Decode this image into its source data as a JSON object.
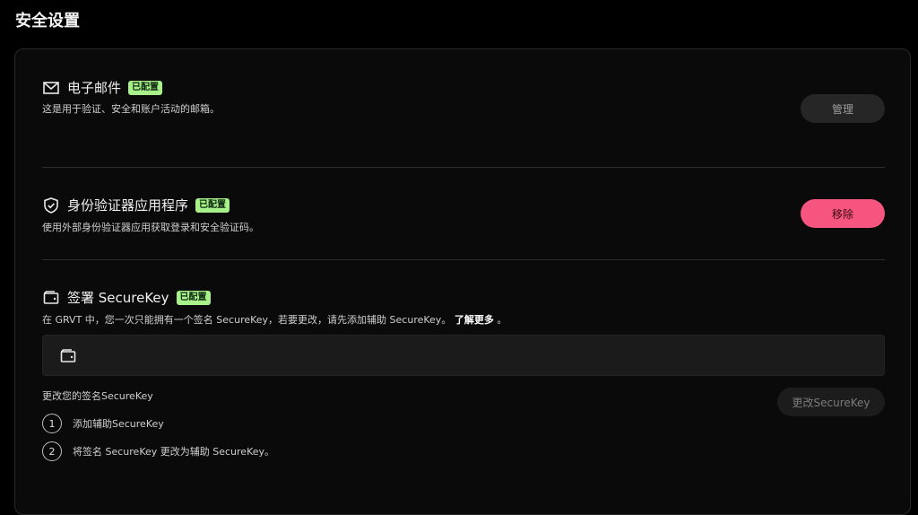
{
  "page": {
    "title": "安全设置"
  },
  "email": {
    "title": "电子邮件",
    "badge": "已配置",
    "description": "这是用于验证、安全和账户活动的邮箱。",
    "button": "管理"
  },
  "authenticator": {
    "title": "身份验证器应用程序",
    "badge": "已配置",
    "description": "使用外部身份验证器应用获取登录和安全验证码。",
    "button": "移除"
  },
  "securekey": {
    "title": "签署 SecureKey",
    "badge": "已配置",
    "description": "在 GRVT 中，您一次只能拥有一个签名 SecureKey，若要更改，请先添加辅助 SecureKey。",
    "learn_more": "了解更多",
    "trailing_dot": "。",
    "change_label": "更改您的签名SecureKey",
    "change_button": "更改SecureKey",
    "steps": [
      {
        "num": "1",
        "text": "添加辅助SecureKey"
      },
      {
        "num": "2",
        "text": "将签名 SecureKey 更改为辅助 SecureKey。"
      }
    ]
  },
  "colors": {
    "accent_pink": "#f5557e",
    "badge_green": "#a8f08a"
  }
}
